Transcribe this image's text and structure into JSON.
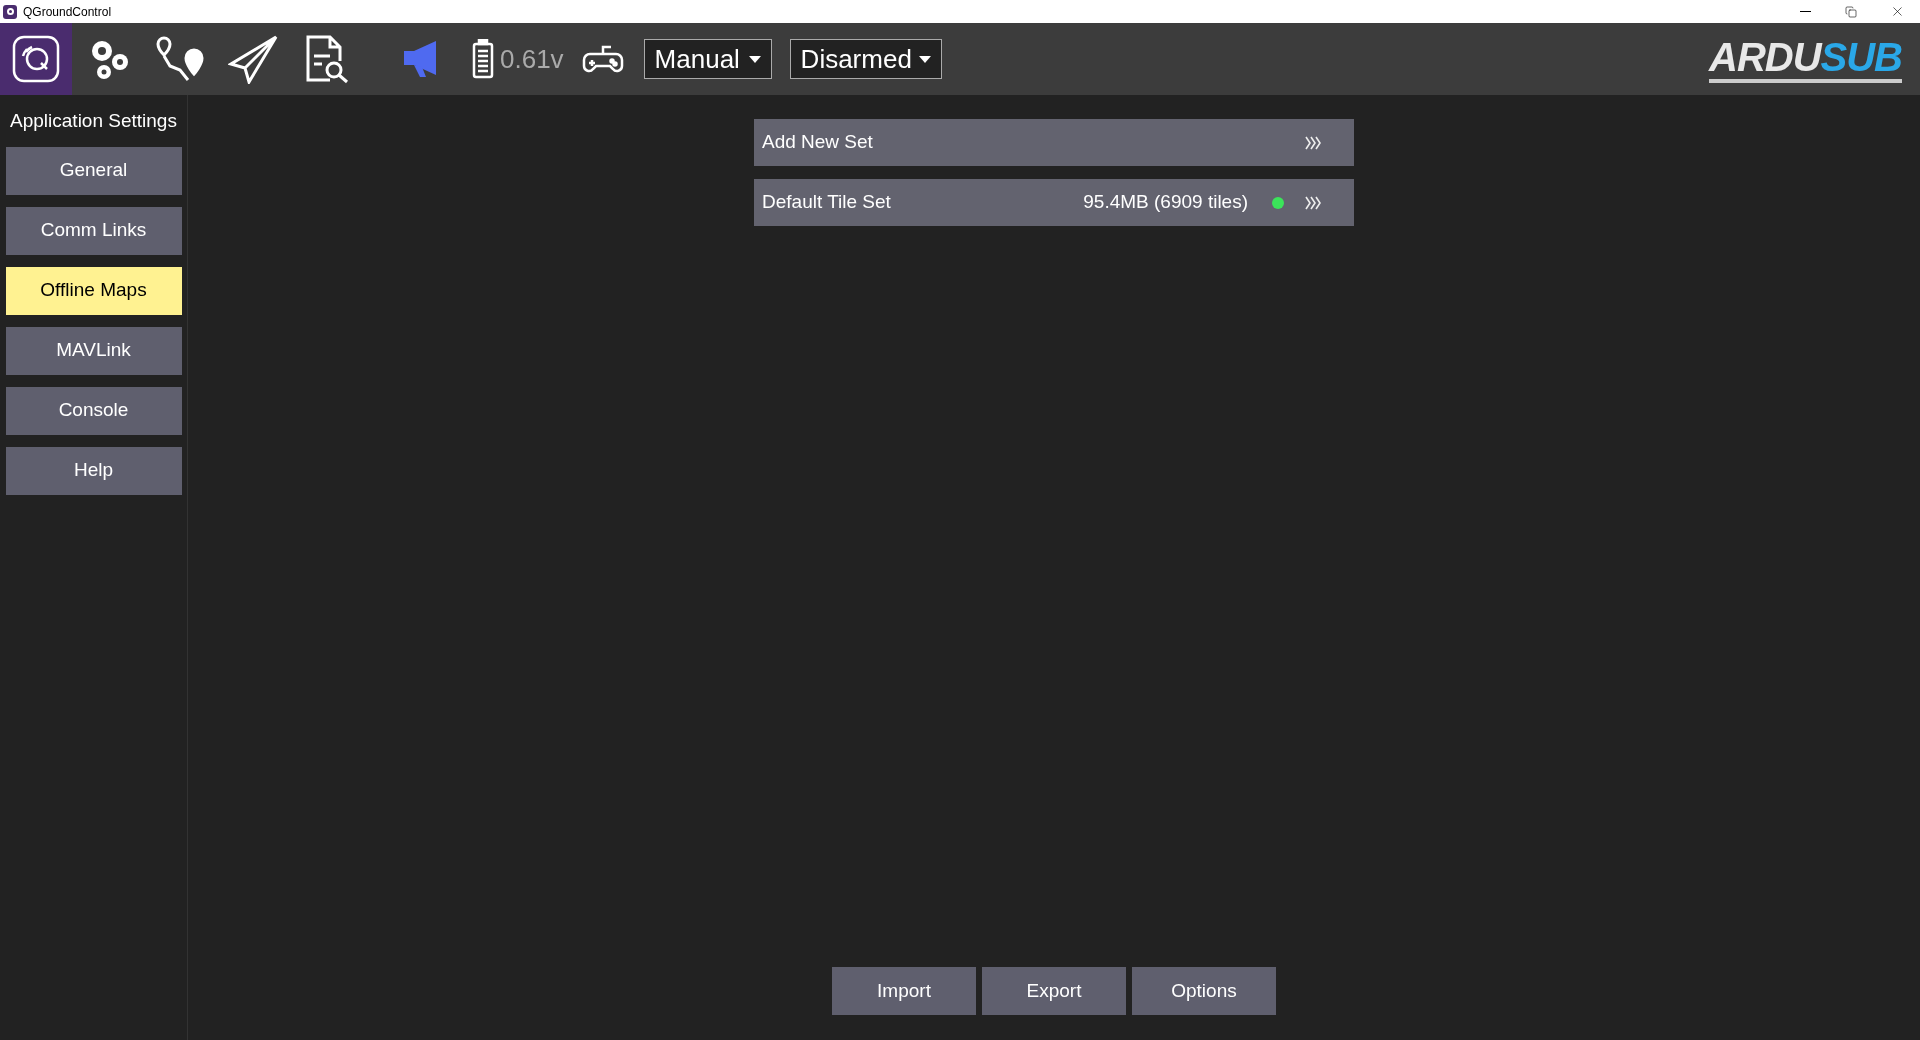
{
  "window": {
    "title": "QGroundControl"
  },
  "toolbar": {
    "battery": "0.61v",
    "flight_mode": "Manual",
    "arm_state": "Disarmed",
    "logo": {
      "part_1": "ARDU",
      "part_2": "SUB"
    }
  },
  "sidebar": {
    "heading": "Application Settings",
    "items": [
      {
        "label": "General",
        "selected": false
      },
      {
        "label": "Comm Links",
        "selected": false
      },
      {
        "label": "Offline Maps",
        "selected": true
      },
      {
        "label": "MAVLink",
        "selected": false
      },
      {
        "label": "Console",
        "selected": false
      },
      {
        "label": "Help",
        "selected": false
      }
    ]
  },
  "tile_sets": [
    {
      "name": "Add New Set"
    },
    {
      "name": "Default Tile Set",
      "size": "95.4MB (6909 tiles)",
      "color": "#3be45a"
    }
  ],
  "buttons": [
    "Import",
    "Export",
    "Options"
  ]
}
